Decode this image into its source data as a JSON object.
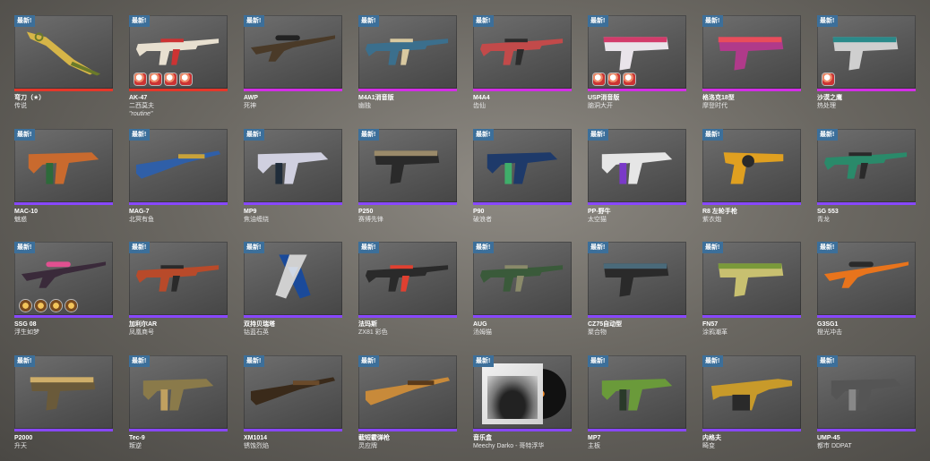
{
  "badge_text": "最新!",
  "colors": {
    "covert": "#e4372a",
    "contraband": "#e4732a",
    "classified": "#d32ee6",
    "restricted": "#8847ff",
    "new_badge": "#3c6f9a"
  },
  "items": [
    {
      "name": "弯刀（★）",
      "finish": "传说",
      "rarity": "covert",
      "icon": "knife-icon",
      "stickers": []
    },
    {
      "name": "AK-47",
      "finish": "二西莫夫",
      "tag": "\"routine\"",
      "rarity": "covert",
      "icon": "rifle-icon",
      "stickers": [
        "sticker-icon",
        "sticker-icon",
        "sticker-icon",
        "sticker-icon"
      ]
    },
    {
      "name": "AWP",
      "finish": "死神",
      "rarity": "classified",
      "icon": "sniper-icon",
      "stickers": []
    },
    {
      "name": "M4A1消音版",
      "finish": "幽独",
      "rarity": "classified",
      "icon": "rifle-icon",
      "stickers": []
    },
    {
      "name": "M4A4",
      "finish": "齿仙",
      "rarity": "classified",
      "icon": "rifle-icon",
      "stickers": []
    },
    {
      "name": "USP消音版",
      "finish": "脑洞大开",
      "rarity": "classified",
      "icon": "pistol-icon",
      "stickers": [
        "sticker-icon",
        "sticker-icon",
        "sticker-icon"
      ]
    },
    {
      "name": "格洛克18型",
      "finish": "摩登时代",
      "rarity": "classified",
      "icon": "pistol-icon",
      "stickers": []
    },
    {
      "name": "沙漠之鹰",
      "finish": "热处理",
      "rarity": "classified",
      "icon": "pistol-icon",
      "stickers": [
        "sticker-icon"
      ]
    },
    {
      "name": "MAC-10",
      "finish": "魅惑",
      "rarity": "restricted",
      "icon": "smg-icon",
      "stickers": []
    },
    {
      "name": "MAG-7",
      "finish": "北冥有鱼",
      "rarity": "restricted",
      "icon": "shotgun-icon",
      "stickers": []
    },
    {
      "name": "MP9",
      "finish": "焦油缠绕",
      "rarity": "restricted",
      "icon": "smg-icon",
      "stickers": []
    },
    {
      "name": "P250",
      "finish": "赛博先锋",
      "rarity": "restricted",
      "icon": "pistol-icon",
      "stickers": []
    },
    {
      "name": "P90",
      "finish": "破浪者",
      "rarity": "restricted",
      "icon": "smg-icon",
      "stickers": []
    },
    {
      "name": "PP-野牛",
      "finish": "太空猫",
      "rarity": "restricted",
      "icon": "smg-icon",
      "stickers": []
    },
    {
      "name": "R8 左轮手枪",
      "finish": "紫衣炮",
      "rarity": "restricted",
      "icon": "revolver-icon",
      "stickers": []
    },
    {
      "name": "SG 553",
      "finish": "青龙",
      "rarity": "restricted",
      "icon": "rifle-icon",
      "stickers": []
    },
    {
      "name": "SSG 08",
      "finish": "浮生如梦",
      "rarity": "restricted",
      "icon": "sniper-icon",
      "stickers": [
        "round",
        "round",
        "round",
        "round"
      ]
    },
    {
      "name": "加利尔AR",
      "finish": "凤凰商号",
      "rarity": "restricted",
      "icon": "rifle-icon",
      "stickers": []
    },
    {
      "name": "双持贝瑞塔",
      "finish": "钴蓝石英",
      "rarity": "restricted",
      "icon": "dual-pistol-icon",
      "stickers": []
    },
    {
      "name": "法玛斯",
      "finish": "ZX81 彩色",
      "rarity": "restricted",
      "icon": "rifle-icon",
      "stickers": []
    },
    {
      "name": "AUG",
      "finish": "汤姆猫",
      "rarity": "restricted",
      "icon": "rifle-icon",
      "stickers": []
    },
    {
      "name": "CZ75自动型",
      "finish": "聚合物",
      "rarity": "restricted",
      "icon": "pistol-icon",
      "stickers": []
    },
    {
      "name": "FN57",
      "finish": "涂鸦潮革",
      "rarity": "restricted",
      "icon": "pistol-icon",
      "stickers": []
    },
    {
      "name": "G3SG1",
      "finish": "橙光冲击",
      "rarity": "restricted",
      "icon": "sniper-icon",
      "stickers": []
    },
    {
      "name": "P2000",
      "finish": "升天",
      "rarity": "restricted",
      "icon": "pistol-icon",
      "stickers": []
    },
    {
      "name": "Tec-9",
      "finish": "叛逆",
      "rarity": "restricted",
      "icon": "smg-icon",
      "stickers": []
    },
    {
      "name": "XM1014",
      "finish": "锈蚀烈焰",
      "rarity": "restricted",
      "icon": "shotgun-icon",
      "stickers": []
    },
    {
      "name": "截短霰弹枪",
      "finish": "灵应牌",
      "rarity": "restricted",
      "icon": "shotgun-icon",
      "stickers": []
    },
    {
      "name": "音乐盒",
      "finish": "Meechy Darko - 哥特浮华",
      "rarity": "restricted",
      "icon": "music-kit-icon",
      "stickers": []
    },
    {
      "name": "MP7",
      "finish": "主板",
      "rarity": "restricted",
      "icon": "smg-icon",
      "stickers": []
    },
    {
      "name": "内格夫",
      "finish": "畸变",
      "rarity": "restricted",
      "icon": "machine-gun-icon",
      "stickers": []
    },
    {
      "name": "UMP-45",
      "finish": "都市 DDPAT",
      "rarity": "restricted",
      "icon": "smg-icon",
      "stickers": []
    }
  ]
}
